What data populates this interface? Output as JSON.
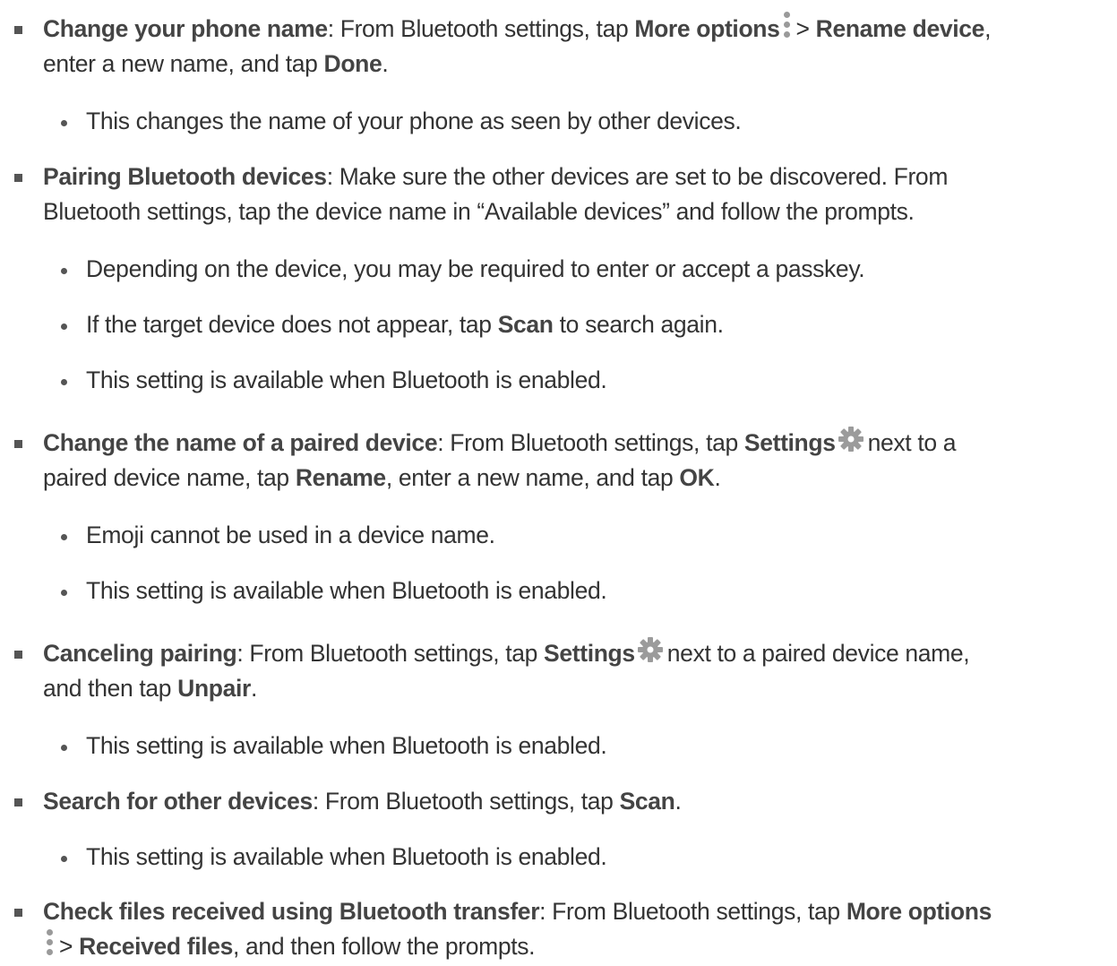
{
  "items": [
    {
      "level": 1,
      "lines": [
        [
          {
            "t": "Change your phone name",
            "b": true
          },
          {
            "t": ": From Bluetooth settings, tap "
          },
          {
            "t": "More options",
            "b": true
          },
          {
            "icon": "more-options-icon"
          },
          {
            "t": "> "
          },
          {
            "t": "Rename device",
            "b": true
          },
          {
            "t": ","
          }
        ],
        [
          {
            "t": "enter a new name, and tap "
          },
          {
            "t": "Done",
            "b": true
          },
          {
            "t": "."
          }
        ]
      ]
    },
    {
      "level": 2,
      "lines": [
        [
          {
            "t": "This changes the name of your phone as seen by other devices."
          }
        ]
      ]
    },
    {
      "level": 1,
      "lines": [
        [
          {
            "t": "Pairing Bluetooth devices",
            "b": true
          },
          {
            "t": ": Make sure the other devices are set to be discovered. From"
          }
        ],
        [
          {
            "t": "Bluetooth settings, tap the device name in “Available devices” and follow the prompts."
          }
        ]
      ]
    },
    {
      "level": 2,
      "lines": [
        [
          {
            "t": "Depending on the device, you may be required to enter or accept a passkey."
          }
        ]
      ]
    },
    {
      "level": 2,
      "lines": [
        [
          {
            "t": "If the target device does not appear, tap "
          },
          {
            "t": "Scan",
            "b": true
          },
          {
            "t": " to search again."
          }
        ]
      ]
    },
    {
      "level": 2,
      "lines": [
        [
          {
            "t": "This setting is available when Bluetooth is enabled."
          }
        ]
      ]
    },
    {
      "level": 1,
      "lines": [
        [
          {
            "t": "Change the name of a paired device",
            "b": true
          },
          {
            "t": ": From Bluetooth settings, tap "
          },
          {
            "t": "Settings",
            "b": true
          },
          {
            "icon": "settings-gear-icon"
          },
          {
            "t": "next to a"
          }
        ],
        [
          {
            "t": "paired device name, tap "
          },
          {
            "t": "Rename",
            "b": true
          },
          {
            "t": ", enter a new name, and tap "
          },
          {
            "t": "OK",
            "b": true
          },
          {
            "t": "."
          }
        ]
      ]
    },
    {
      "level": 2,
      "lines": [
        [
          {
            "t": "Emoji cannot be used in a device name."
          }
        ]
      ]
    },
    {
      "level": 2,
      "lines": [
        [
          {
            "t": "This setting is available when Bluetooth is enabled."
          }
        ]
      ]
    },
    {
      "level": 1,
      "lines": [
        [
          {
            "t": "Canceling pairing",
            "b": true
          },
          {
            "t": ": From Bluetooth settings, tap "
          },
          {
            "t": "Settings",
            "b": true
          },
          {
            "icon": "settings-gear-icon"
          },
          {
            "t": "next to a paired device name,"
          }
        ],
        [
          {
            "t": "and then tap "
          },
          {
            "t": "Unpair",
            "b": true
          },
          {
            "t": "."
          }
        ]
      ]
    },
    {
      "level": 2,
      "lines": [
        [
          {
            "t": "This setting is available when Bluetooth is enabled."
          }
        ]
      ]
    },
    {
      "level": 1,
      "lines": [
        [
          {
            "t": "Search for other devices",
            "b": true
          },
          {
            "t": ": From Bluetooth settings, tap "
          },
          {
            "t": "Scan",
            "b": true
          },
          {
            "t": "."
          }
        ]
      ]
    },
    {
      "level": 2,
      "lines": [
        [
          {
            "t": "This setting is available when Bluetooth is enabled."
          }
        ]
      ]
    },
    {
      "level": 1,
      "lines": [
        [
          {
            "t": "Check files received using Bluetooth transfer",
            "b": true
          },
          {
            "t": ": From Bluetooth settings, tap "
          },
          {
            "t": "More options",
            "b": true
          }
        ],
        [
          {
            "icon": "more-options-icon"
          },
          {
            "t": "> "
          },
          {
            "t": "Received files",
            "b": true
          },
          {
            "t": ", and then follow the prompts."
          }
        ]
      ]
    }
  ]
}
